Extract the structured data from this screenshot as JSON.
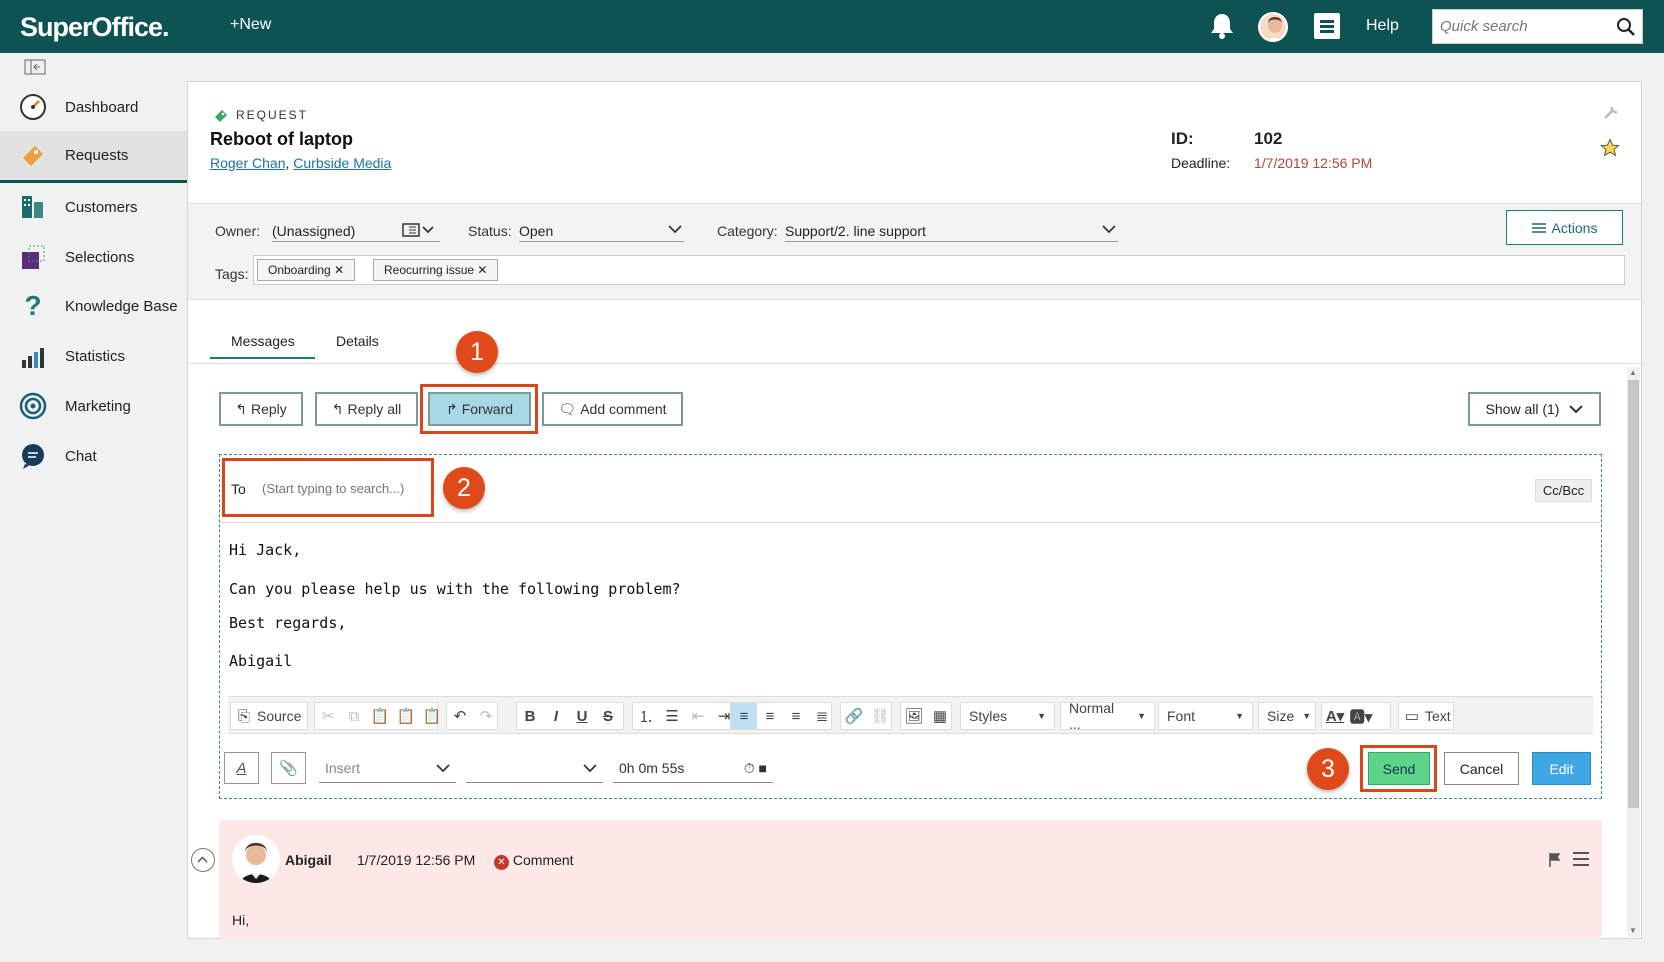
{
  "app": {
    "logo": "SuperOffice.",
    "new_label": "New",
    "help_label": "Help",
    "search_placeholder": "Quick search"
  },
  "nav": [
    {
      "label": "Dashboard"
    },
    {
      "label": "Requests"
    },
    {
      "label": "Customers"
    },
    {
      "label": "Selections"
    },
    {
      "label": "Knowledge Base"
    },
    {
      "label": "Statistics"
    },
    {
      "label": "Marketing"
    },
    {
      "label": "Chat"
    }
  ],
  "request": {
    "type_label": "REQUEST",
    "title": "Reboot of laptop",
    "contact_person": "Roger Chan",
    "contact_sep": ",",
    "company": "Curbside Media",
    "id_label": "ID:",
    "id_value": "102",
    "deadline_label": "Deadline:",
    "deadline_value": "1/7/2019 12:56 PM"
  },
  "fields": {
    "owner_label": "Owner:",
    "owner_value": "(Unassigned)",
    "status_label": "Status:",
    "status_value": "Open",
    "category_label": "Category:",
    "category_value": "Support/2. line support",
    "actions_label": "Actions",
    "tags_label": "Tags:",
    "tags": [
      "Onboarding",
      "Reocurring issue"
    ]
  },
  "tabs": {
    "messages": "Messages",
    "details": "Details"
  },
  "message_actions": {
    "reply": "Reply",
    "reply_all": "Reply all",
    "forward": "Forward",
    "add_comment": "Add comment",
    "show_all": "Show all (1)"
  },
  "compose": {
    "to_label": "To",
    "to_placeholder": "(Start typing to search...)",
    "cc_bcc": "Cc/Bcc",
    "body": [
      "Hi Jack,",
      "Can you please help us with the following problem?",
      "Best regards,",
      "Abigail"
    ],
    "toolbar": {
      "source": "Source",
      "styles": "Styles",
      "format": "Normal ...",
      "font": "Font",
      "size": "Size",
      "text": "Text"
    },
    "insert_placeholder": "Insert",
    "timer": "0h 0m 55s",
    "send": "Send",
    "cancel": "Cancel",
    "edit": "Edit"
  },
  "comment": {
    "author": "Abigail",
    "date": "1/7/2019 12:56 PM",
    "type": "Comment",
    "body": "Hi,"
  },
  "annotations": {
    "one": "1",
    "two": "2",
    "three": "3"
  },
  "colors": {
    "header": "#0d5353",
    "accent": "#1a7c7c",
    "send": "#5ed48a",
    "edit": "#3fa7e3",
    "annotation": "#e04a1a",
    "comment_bg": "#fde8e8"
  }
}
